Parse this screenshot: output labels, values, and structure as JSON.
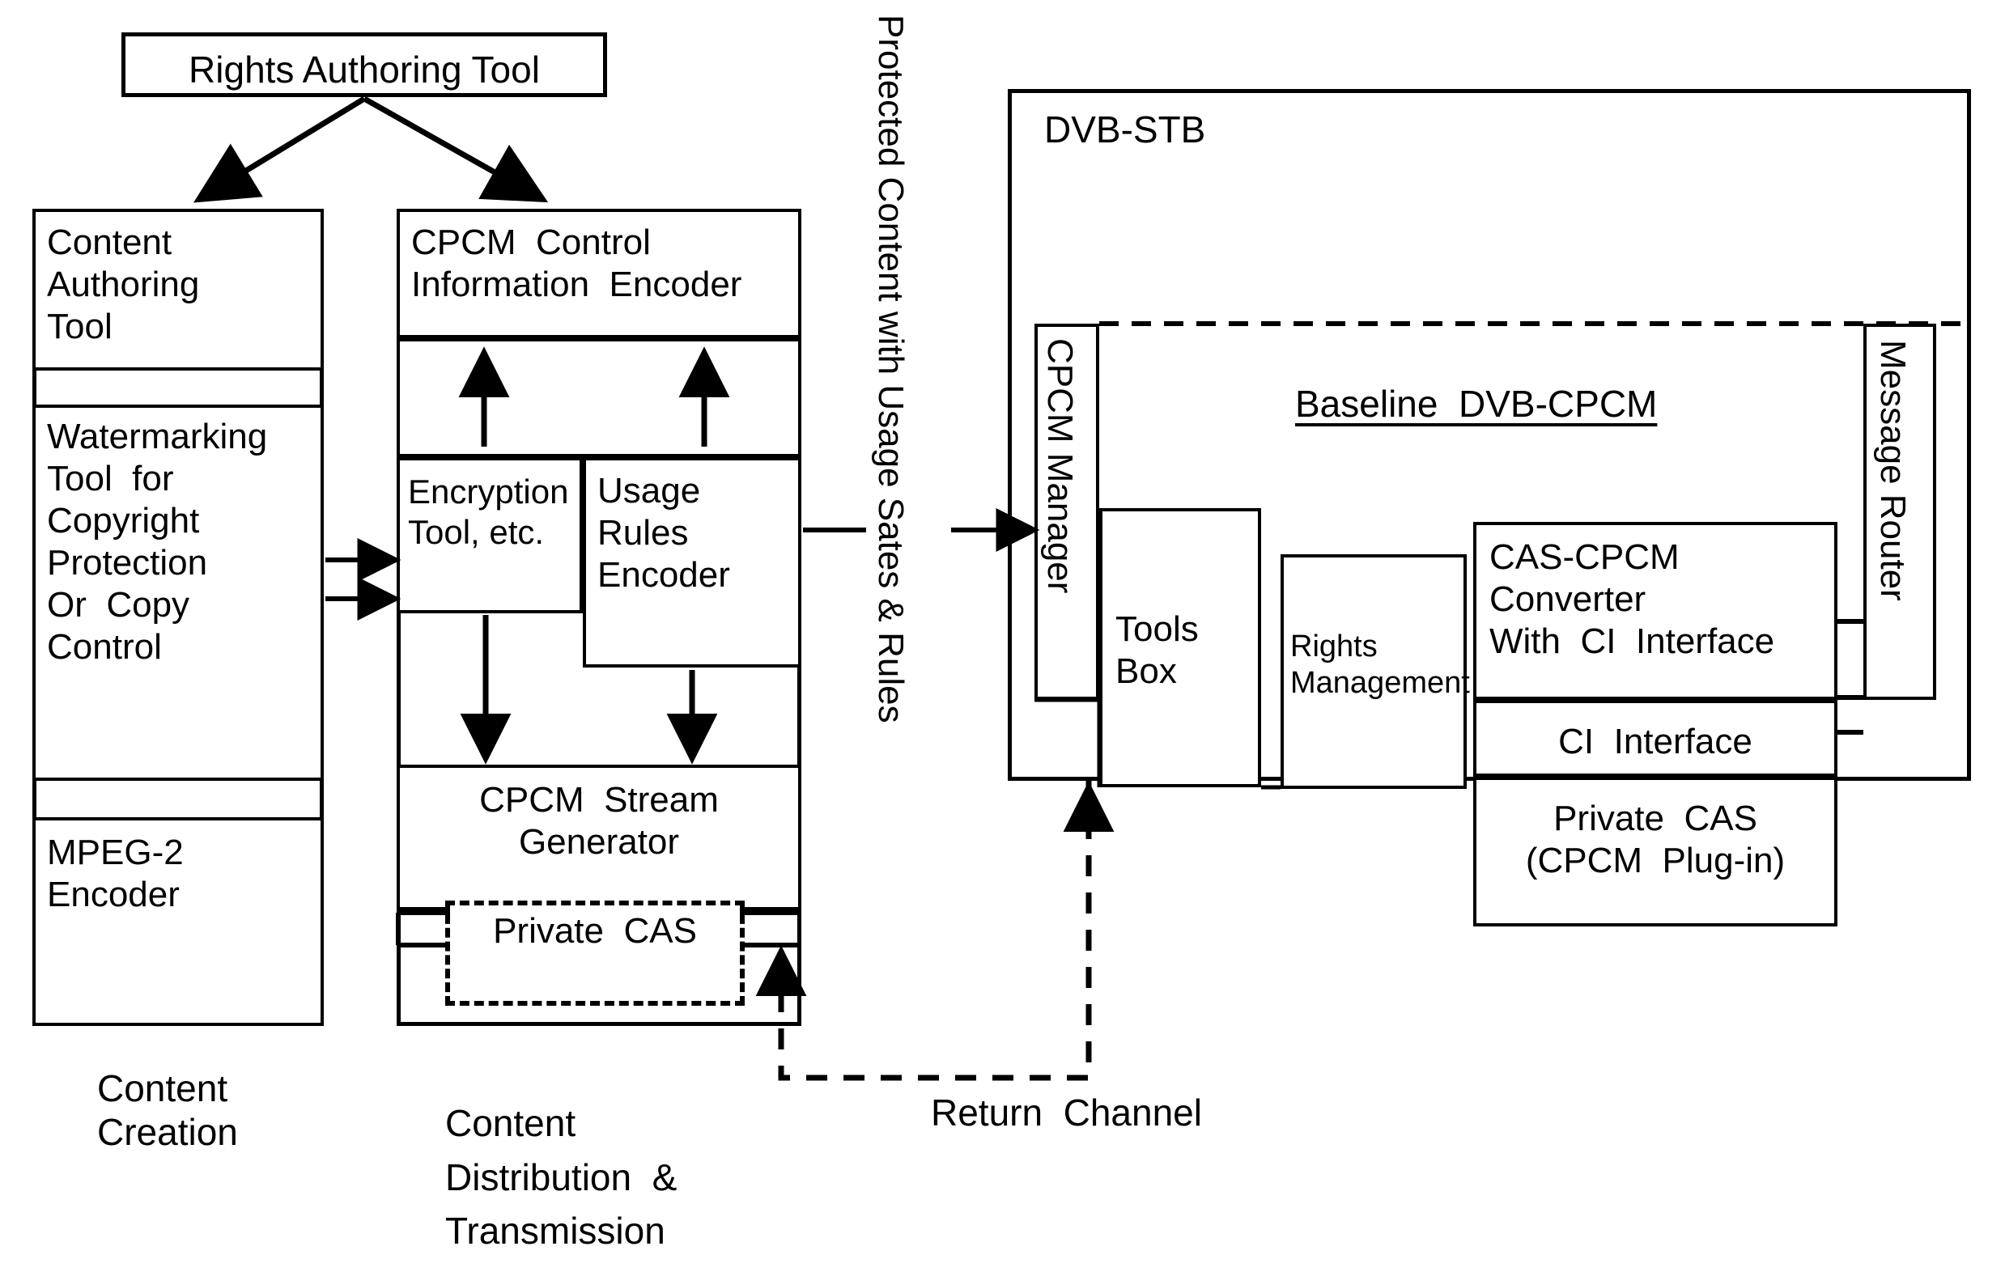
{
  "diagram": {
    "title_note": "DVB-CPCM content protection architecture block diagram",
    "boxes": {
      "rights_authoring_tool": "Rights Authoring Tool",
      "content_authoring_tool": "Content\nAuthoring\nTool",
      "watermarking_tool": "Watermarking\nTool  for\nCopyright\nProtection\nOr  Copy\nControl",
      "mpeg2_encoder": "MPEG-2\nEncoder",
      "cpcm_control_information_encoder": "CPCM  Control\nInformation  Encoder",
      "encryption_tool": "Encryption\nTool, etc.",
      "usage_rules_encoder": "Usage\nRules\nEncoder",
      "cpcm_stream_generator": "CPCM  Stream\nGenerator",
      "private_cas_dashed": "Private  CAS",
      "dvb_stb": "DVB-STB",
      "baseline_dvb_cpcm": "Baseline  DVB-CPCM",
      "cpcm_manager": "CPCM Manager",
      "tools_box": "Tools\nBox",
      "rights_management": "Rights\nManagement",
      "cas_cpcm_converter": "CAS-CPCM\nConverter\nWith  CI  Interface",
      "ci_interface": "CI  Interface",
      "private_cas_plugin": "Private  CAS\n(CPCM  Plug-in)",
      "message_router": "Message Router"
    },
    "connector_labels": {
      "protected_content": "Protected Content with Usage Sates & Rules",
      "return_channel": "Return  Channel"
    },
    "group_labels": {
      "content_creation": "Content\nCreation",
      "content_distribution": "Content\nDistribution  &\nTransmission"
    },
    "colors": {
      "stroke": "#000000",
      "background": "#ffffff"
    }
  }
}
